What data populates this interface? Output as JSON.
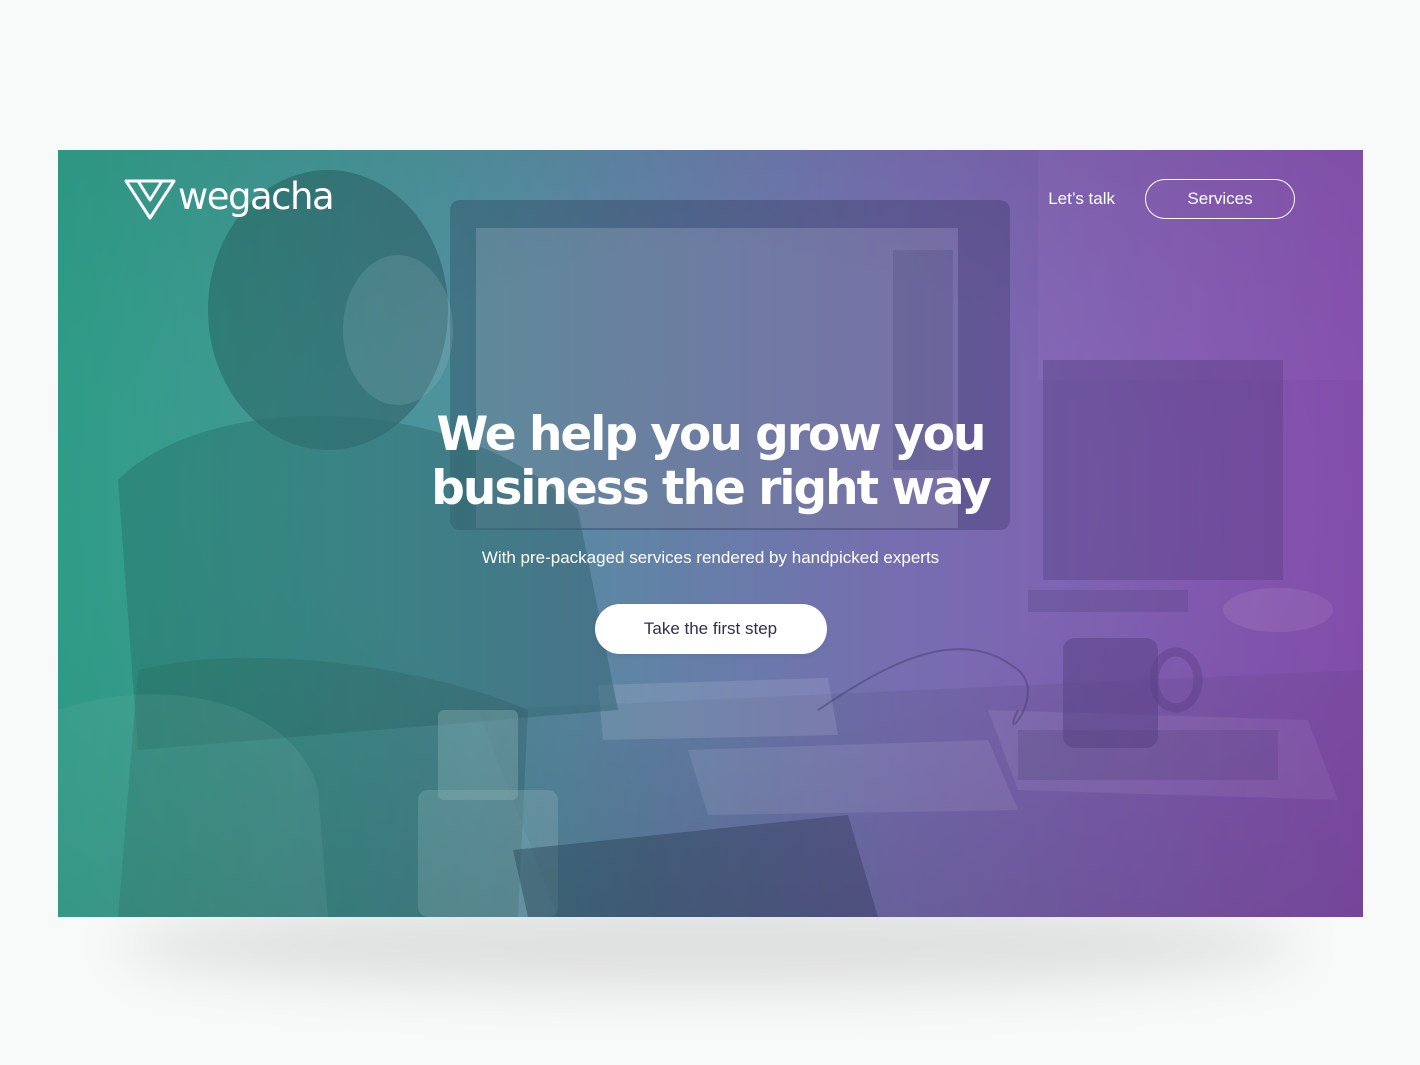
{
  "brand": {
    "name": "wegacha",
    "logo_icon": "triangle-logo-icon"
  },
  "nav": {
    "lets_talk": "Let’s talk",
    "services": "Services"
  },
  "hero": {
    "headline_line1": "We help you grow you",
    "headline_line2": "business the right way",
    "subheadline": "With pre-packaged services rendered by handpicked experts",
    "cta_label": "Take the first step"
  },
  "colors": {
    "page_background": "#f8f9f9",
    "gradient_start": "#3aa394",
    "gradient_end": "#8a56ad",
    "cta_text": "#2f2f4f",
    "text": "#ffffff"
  }
}
